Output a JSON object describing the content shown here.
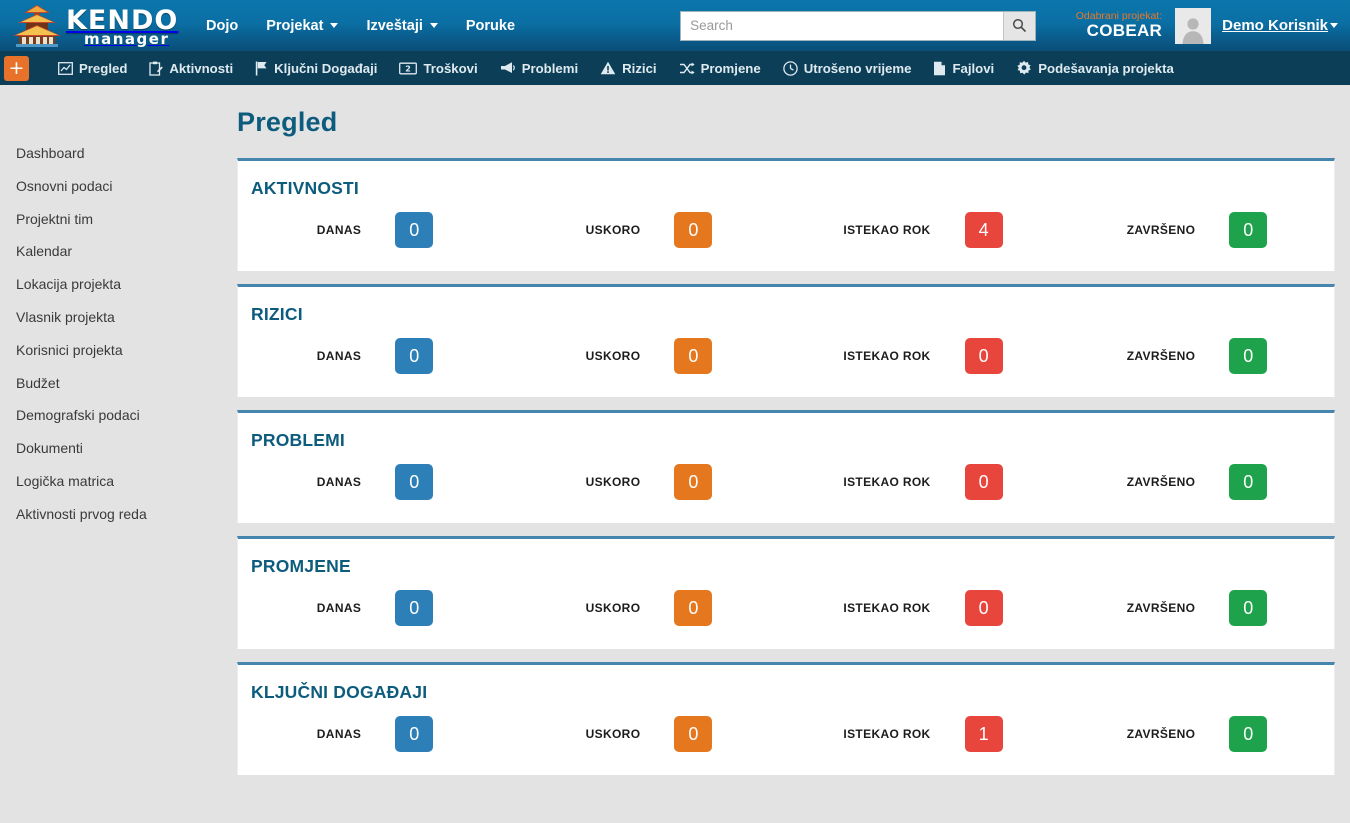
{
  "brand": {
    "name_top": "KENDO",
    "name_bottom": "manager",
    "logo_icon": "pagoda-icon"
  },
  "header": {
    "nav": [
      {
        "label": "Dojo",
        "has_caret": false
      },
      {
        "label": "Projekat",
        "has_caret": true
      },
      {
        "label": "Izveštaji",
        "has_caret": true
      },
      {
        "label": "Poruke",
        "has_caret": false
      }
    ],
    "search": {
      "value": "",
      "placeholder": "Search",
      "icon": "search-icon"
    },
    "selected_project_label": "Odabrani projekat:",
    "selected_project_name": "COBEAR",
    "user_name": "Demo Korisnik",
    "avatar_icon": "user-avatar-icon"
  },
  "subnav": {
    "add_label": "+",
    "items": [
      {
        "label": "Pregled",
        "icon": "chart-box-icon"
      },
      {
        "label": "Aktivnosti",
        "icon": "clipboard-pencil-icon"
      },
      {
        "label": "Ključni Događaji",
        "icon": "flag-icon"
      },
      {
        "label": "Troškovi",
        "icon": "banknote-icon"
      },
      {
        "label": "Problemi",
        "icon": "megaphone-icon"
      },
      {
        "label": "Rizici",
        "icon": "warning-triangle-icon"
      },
      {
        "label": "Promjene",
        "icon": "shuffle-icon"
      },
      {
        "label": "Utrošeno vrijeme",
        "icon": "clock-icon"
      },
      {
        "label": "Fajlovi",
        "icon": "file-icon"
      },
      {
        "label": "Podešavanja projekta",
        "icon": "gear-icon"
      }
    ]
  },
  "sidebar": {
    "items": [
      {
        "label": "Dashboard"
      },
      {
        "label": "Osnovni podaci"
      },
      {
        "label": "Projektni tim"
      },
      {
        "label": "Kalendar"
      },
      {
        "label": "Lokacija projekta"
      },
      {
        "label": "Vlasnik projekta"
      },
      {
        "label": "Korisnici projekta"
      },
      {
        "label": "Budžet"
      },
      {
        "label": "Demografski podaci"
      },
      {
        "label": "Dokumenti"
      },
      {
        "label": "Logička matrica"
      },
      {
        "label": "Aktivnosti prvog reda"
      }
    ]
  },
  "main": {
    "title": "Pregled",
    "metric_labels": {
      "today": "DANAS",
      "soon": "USKORO",
      "overdue": "ISTEKAO ROK",
      "done": "ZAVRŠENO"
    },
    "cards": [
      {
        "title": "AKTIVNOSTI",
        "metrics": [
          {
            "label": "DANAS",
            "value": "0",
            "color_class": "b-blue",
            "color": "#2d7fb8"
          },
          {
            "label": "USKORO",
            "value": "0",
            "color_class": "b-orange",
            "color": "#e5771f"
          },
          {
            "label": "ISTEKAO ROK",
            "value": "4",
            "color_class": "b-red",
            "color": "#e8453c"
          },
          {
            "label": "ZAVRŠENO",
            "value": "0",
            "color_class": "b-green",
            "color": "#1fa24c"
          }
        ]
      },
      {
        "title": "RIZICI",
        "metrics": [
          {
            "label": "DANAS",
            "value": "0",
            "color_class": "b-blue",
            "color": "#2d7fb8"
          },
          {
            "label": "USKORO",
            "value": "0",
            "color_class": "b-orange",
            "color": "#e5771f"
          },
          {
            "label": "ISTEKAO ROK",
            "value": "0",
            "color_class": "b-red",
            "color": "#e8453c"
          },
          {
            "label": "ZAVRŠENO",
            "value": "0",
            "color_class": "b-green",
            "color": "#1fa24c"
          }
        ]
      },
      {
        "title": "PROBLEMI",
        "metrics": [
          {
            "label": "DANAS",
            "value": "0",
            "color_class": "b-blue",
            "color": "#2d7fb8"
          },
          {
            "label": "USKORO",
            "value": "0",
            "color_class": "b-orange",
            "color": "#e5771f"
          },
          {
            "label": "ISTEKAO ROK",
            "value": "0",
            "color_class": "b-red",
            "color": "#e8453c"
          },
          {
            "label": "ZAVRŠENO",
            "value": "0",
            "color_class": "b-green",
            "color": "#1fa24c"
          }
        ]
      },
      {
        "title": "PROMJENE",
        "metrics": [
          {
            "label": "DANAS",
            "value": "0",
            "color_class": "b-blue",
            "color": "#2d7fb8"
          },
          {
            "label": "USKORO",
            "value": "0",
            "color_class": "b-orange",
            "color": "#e5771f"
          },
          {
            "label": "ISTEKAO ROK",
            "value": "0",
            "color_class": "b-red",
            "color": "#e8453c"
          },
          {
            "label": "ZAVRŠENO",
            "value": "0",
            "color_class": "b-green",
            "color": "#1fa24c"
          }
        ]
      },
      {
        "title": "KLJUČNI DOGAĐAJI",
        "metrics": [
          {
            "label": "DANAS",
            "value": "0",
            "color_class": "b-blue",
            "color": "#2d7fb8"
          },
          {
            "label": "USKORO",
            "value": "0",
            "color_class": "b-orange",
            "color": "#e5771f"
          },
          {
            "label": "ISTEKAO ROK",
            "value": "1",
            "color_class": "b-red",
            "color": "#e8453c"
          },
          {
            "label": "ZAVRŠENO",
            "value": "0",
            "color_class": "b-green",
            "color": "#1fa24c"
          }
        ]
      }
    ]
  },
  "colors": {
    "header_blue": "#0b6fa4",
    "subnav_navy": "#0c3f57",
    "accent_orange": "#e8722a",
    "title_blue": "#0d5c7e",
    "card_border": "#4685ad",
    "page_bg": "#e3e3e3"
  }
}
